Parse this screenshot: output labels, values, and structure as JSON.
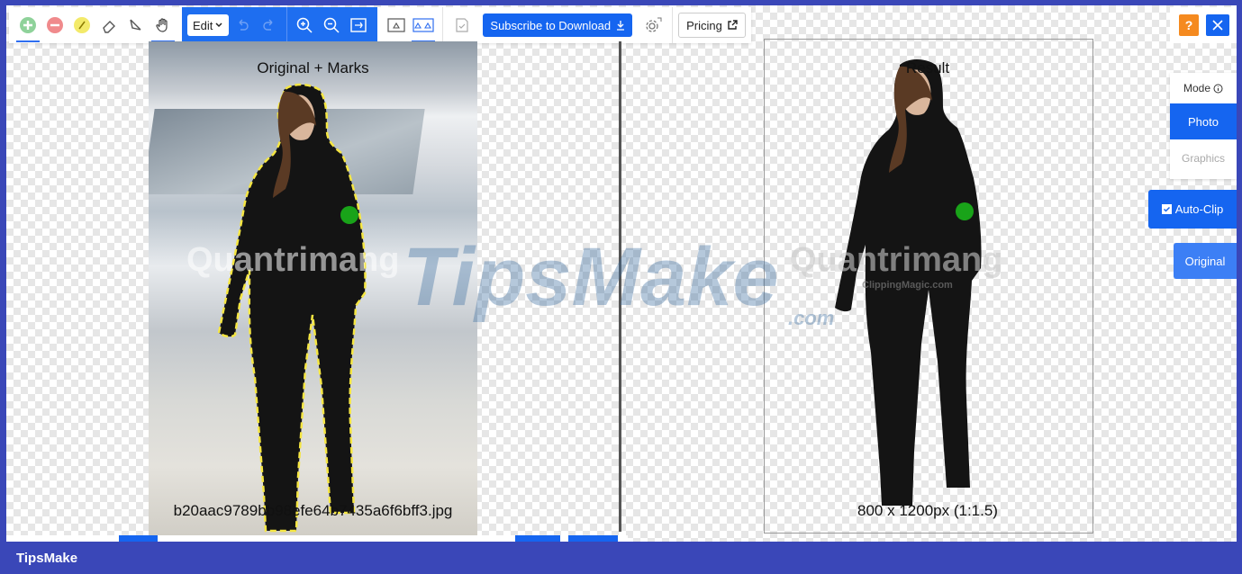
{
  "toolbar": {
    "edit_select_value": "Edit",
    "subscribe_label": "Subscribe to Download",
    "pricing_label": "Pricing"
  },
  "panes": {
    "left_title": "Original + Marks",
    "left_filename": "b20aac9789bb98efe64b7435a6f6bff3.jpg",
    "right_title": "Result",
    "right_size": "800 x 1200px (1:1.5)"
  },
  "side": {
    "mode_label": "Mode",
    "photo_label": "Photo",
    "graphics_label": "Graphics",
    "autoclip_label": "Auto-Clip",
    "original_label": "Original"
  },
  "watermark": {
    "text1": "Quantrimang",
    "text2": "TipsMake",
    "text3": ".com",
    "text4": "ClippingMagic.com"
  },
  "footer": {
    "brand": "TipsMake"
  },
  "colors": {
    "accent": "#1e6ef0",
    "keep_mark": "#19a319",
    "remove_mark": "#e5454a",
    "hair_mark": "#f5e642",
    "help_orange": "#f58a1f"
  }
}
